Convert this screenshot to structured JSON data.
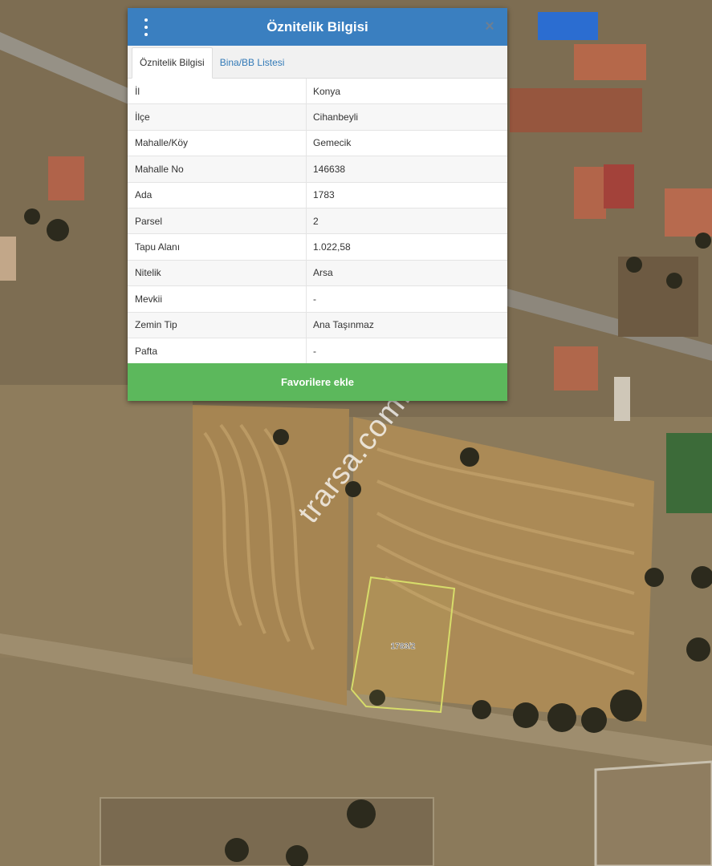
{
  "panel": {
    "title": "Öznitelik Bilgisi",
    "menu_icon": "vertical-dots-icon",
    "close_label": "×",
    "tabs": [
      {
        "label": "Öznitelik Bilgisi",
        "active": true
      },
      {
        "label": "Bina/BB Listesi",
        "active": false
      }
    ],
    "rows": [
      {
        "key": "İl",
        "value": "Konya"
      },
      {
        "key": "İlçe",
        "value": "Cihanbeyli"
      },
      {
        "key": "Mahalle/Köy",
        "value": "Gemecik"
      },
      {
        "key": "Mahalle No",
        "value": "146638"
      },
      {
        "key": "Ada",
        "value": "1783"
      },
      {
        "key": "Parsel",
        "value": "2"
      },
      {
        "key": "Tapu Alanı",
        "value": "1.022,58"
      },
      {
        "key": "Nitelik",
        "value": "Arsa"
      },
      {
        "key": "Mevkii",
        "value": "-"
      },
      {
        "key": "Zemin Tip",
        "value": "Ana Taşınmaz"
      },
      {
        "key": "Pafta",
        "value": "-"
      }
    ],
    "favorite_button": "Favorilere ekle"
  },
  "map": {
    "parcel_label": "1783/2",
    "parcel_outline_color": "#d7dc6a"
  },
  "watermark": "trarsa.com.tr",
  "colors": {
    "header": "#3a7fc0",
    "favorite_button": "#5cb85c",
    "tab_link": "#337ab7"
  }
}
